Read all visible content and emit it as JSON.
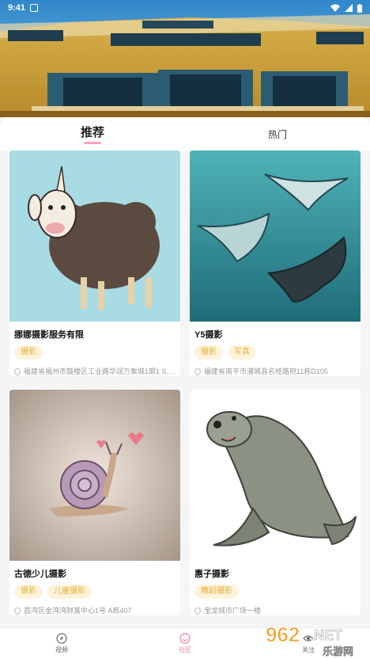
{
  "status_bar": {
    "time": "9:41"
  },
  "tabs": [
    {
      "label": "推荐",
      "active": true
    },
    {
      "label": "热门",
      "active": false
    }
  ],
  "cards": [
    {
      "title": "挪娜摄影服务有限",
      "tags": [
        "摄影"
      ],
      "address": "福建省福州市鼓楼区工业路华润万象城1期1 S5-1...",
      "image": "sheep-illustration"
    },
    {
      "title": "Y5摄影",
      "tags": [
        "摄影",
        "写真"
      ],
      "address": "福建省南平市浦城县名桂路府11栋D105",
      "image": "manta-ray-illustration"
    },
    {
      "title": "古德少儿摄影",
      "tags": [
        "摄影",
        "儿童摄影"
      ],
      "address": "荔湾区金湾湾财富中心1号 A栋407",
      "image": "snail-illustration"
    },
    {
      "title": "惠子摄影",
      "tags": [
        "舞蹈摄影"
      ],
      "address": "宝龙城市广场一楼",
      "image": "sea-lion-illustration"
    }
  ],
  "bottom_nav": [
    {
      "label": "视频",
      "icon": "compass-icon",
      "active": false
    },
    {
      "label": "社区",
      "icon": "smile-icon",
      "active": true
    },
    {
      "label": "关注",
      "icon": "eye-icon",
      "active": false
    }
  ],
  "watermark": {
    "brand": "962",
    "suffix": ".NET",
    "subtitle": "乐游网"
  },
  "colors": {
    "accent": "#f07aa0",
    "tag_bg": "#fdf3dc",
    "tag_text": "#e6b23a"
  }
}
